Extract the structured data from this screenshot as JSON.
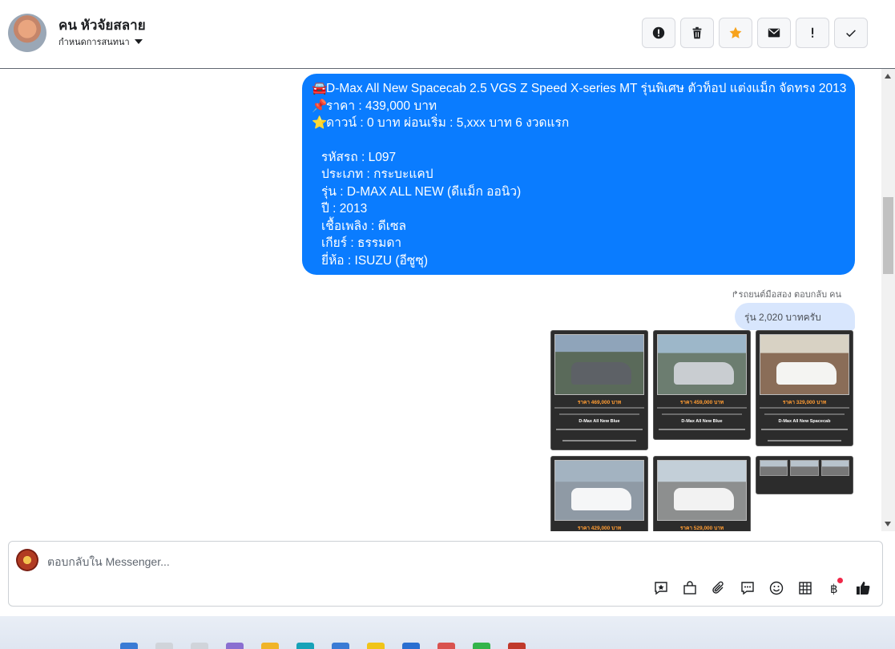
{
  "header": {
    "contact_name": "คน หัวจัยสลาย",
    "assign_label": "กำหนดการสนทนา",
    "actions": [
      {
        "name": "mark-spam",
        "icon": "alert-circle-icon"
      },
      {
        "name": "delete",
        "icon": "trash-icon"
      },
      {
        "name": "star",
        "icon": "star-icon"
      },
      {
        "name": "mark-unread",
        "icon": "envelope-icon"
      },
      {
        "name": "important",
        "icon": "exclamation-icon"
      },
      {
        "name": "done",
        "icon": "checkmark-icon"
      }
    ]
  },
  "message": {
    "title": "D-Max All New Spacecab 2.5 VGS Z Speed X-series MT รุ่นพิเศษ ตัวท็อป แต่งแม็ก จัดทรง 2013",
    "price": "ราคา : 439,000 บาท",
    "down": "ดาวน์ : 0 บาท ผ่อนเริ่ม : 5,xxx บาท 6 งวดแรก",
    "code": "รหัสรถ : L097",
    "type": "ประเภท : กระบะแคป",
    "model": "รุ่น : D-MAX ALL NEW (ดีแม็ก ออนิว)",
    "year": "ปี : 2013",
    "fuel": "เชื้อเพลิง : ดีเซล",
    "gear": "เกียร์ : ธรรมดา",
    "brand": "ยี่ห้อ : ISUZU (อีซูซุ)",
    "emoji_car": "🚘",
    "emoji_pin": "📌",
    "emoji_star": "⭐"
  },
  "reply_note": "รถยนต์มือสอง ตอบกลับ คน",
  "reply_text": "รุ่น 2,020 บาทครับ",
  "cards": [
    {
      "price": "ราคา 469,000 บาท",
      "model": "D-Max All New Blue"
    },
    {
      "price": "ราคา 459,000 บาท",
      "model": "D-Max All New Blue"
    },
    {
      "price": "ราคา 329,000 บาท",
      "model": "D-Max All New Spacecab"
    },
    {
      "price": "ราคา 429,000 บาท",
      "model": ""
    },
    {
      "price": "ราคา 529,000 บาท",
      "model": ""
    }
  ],
  "composer": {
    "placeholder": "ตอบกลับใน Messenger...",
    "tools": [
      "saved-reply-icon",
      "shop-icon",
      "attachment-icon",
      "chat-icon",
      "emoji-icon",
      "table-icon",
      "baht-icon",
      "thumbs-up-icon"
    ]
  },
  "colors": {
    "accent": "#0a7cff",
    "reply_bubble": "#d8e6fd",
    "star": "#f7a21b"
  }
}
